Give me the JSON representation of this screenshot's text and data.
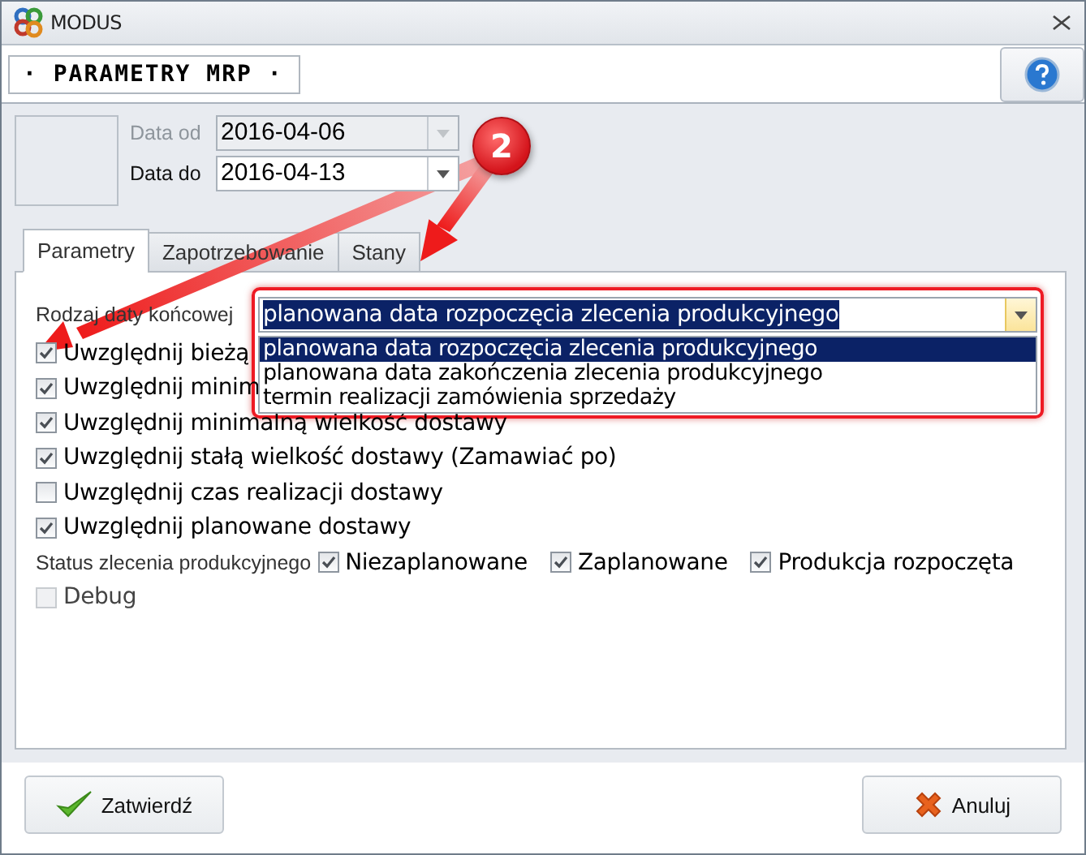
{
  "window": {
    "title": "MODUS"
  },
  "header": {
    "title": "· PARAMETRY MRP ·"
  },
  "dates": [
    {
      "label": "Data od",
      "value": "2016-04-06",
      "disabled": true
    },
    {
      "label": "Data do",
      "value": "2016-04-13",
      "disabled": false
    }
  ],
  "tabs": [
    {
      "label": "Parametry",
      "selected": true
    },
    {
      "label": "Zapotrzebowanie",
      "selected": false
    },
    {
      "label": "Stany",
      "selected": false
    }
  ],
  "end_date": {
    "label": "Rodzaj daty końcowej",
    "value": "planowana data rozpoczęcia zlecenia produkcyjnego",
    "expanded": true,
    "options": [
      {
        "label": "planowana data rozpoczęcia zlecenia produkcyjnego",
        "selected": true
      },
      {
        "label": "planowana data zakończenia zlecenia produkcyjnego",
        "selected": false
      },
      {
        "label": "termin realizacji zamówienia sprzedaży",
        "selected": false
      }
    ]
  },
  "options": [
    {
      "label": "Uwzględnij bieżą",
      "checked": true,
      "disabled": false
    },
    {
      "label": "Uwzględnij minim",
      "checked": true,
      "disabled": false
    },
    {
      "label": "Uwzględnij minimalną wielkość dostawy",
      "checked": true,
      "disabled": false
    },
    {
      "label": "Uwzględnij stałą wielkość dostawy (Zamawiać po)",
      "checked": true,
      "disabled": false
    },
    {
      "label": "Uwzględnij czas realizacji dostawy",
      "checked": false,
      "disabled": false
    },
    {
      "label": "Uwzględnij planowane dostawy",
      "checked": true,
      "disabled": false
    }
  ],
  "status": {
    "label": "Status zlecenia produkcyjnego",
    "options": [
      {
        "label": "Niezaplanowane",
        "checked": true
      },
      {
        "label": "Zaplanowane",
        "checked": true
      },
      {
        "label": "Produkcja rozpoczęta",
        "checked": true
      }
    ]
  },
  "debug": {
    "label": "Debug",
    "checked": false,
    "disabled": true
  },
  "callout": {
    "number": "2"
  },
  "buttons": [
    {
      "label": "Zatwierdź",
      "kind": "confirm"
    },
    {
      "label": "Anuluj",
      "kind": "cancel"
    }
  ]
}
